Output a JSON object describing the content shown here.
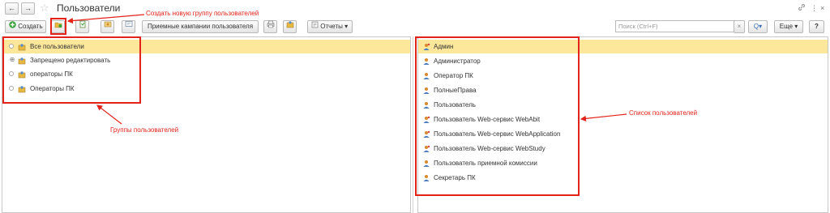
{
  "window": {
    "title": "Пользователи",
    "nav_back": "←",
    "nav_forward": "→",
    "link_icon": "link-icon",
    "more_icon": "more-vertical-icon",
    "close_glyph": "×"
  },
  "toolbar": {
    "create_label": "Создать",
    "campaigns_label": "Приемные кампании пользователя",
    "reports_label": "Отчеты",
    "search_placeholder": "Поиск (Ctrl+F)",
    "clear_glyph": "×",
    "search_glyph": "Q",
    "more_label": "Еще",
    "help_label": "?"
  },
  "groups": {
    "items": [
      {
        "label": "Все пользователи",
        "selected": true
      },
      {
        "label": "Запрещено редактировать",
        "selected": false
      },
      {
        "label": "операторы ПК",
        "selected": false
      },
      {
        "label": "Операторы ПК",
        "selected": false
      }
    ]
  },
  "users": {
    "items": [
      {
        "label": "Админ",
        "selected": true
      },
      {
        "label": "Администратор",
        "selected": false
      },
      {
        "label": "Оператор ПК",
        "selected": false
      },
      {
        "label": "ПолныеПрава",
        "selected": false
      },
      {
        "label": "Пользователь",
        "selected": false
      },
      {
        "label": "Пользователь Web-сервис WebAbit",
        "selected": false
      },
      {
        "label": "Пользователь Web-сервис WebApplication",
        "selected": false
      },
      {
        "label": "Пользователь Web-сервис WebStudy",
        "selected": false
      },
      {
        "label": "Пользователь приемной комиссии",
        "selected": false
      },
      {
        "label": "Секретарь ПК",
        "selected": false
      }
    ]
  },
  "annotations": {
    "create_group": "Создать новую группу пользователей",
    "groups_caption": "Группы пользователей",
    "users_caption": "Список пользователей",
    "color": "#e32219"
  },
  "colors": {
    "selected_row": "#fce79a",
    "create_icon": "#3aa43a",
    "user_icon": "#d8892b"
  }
}
